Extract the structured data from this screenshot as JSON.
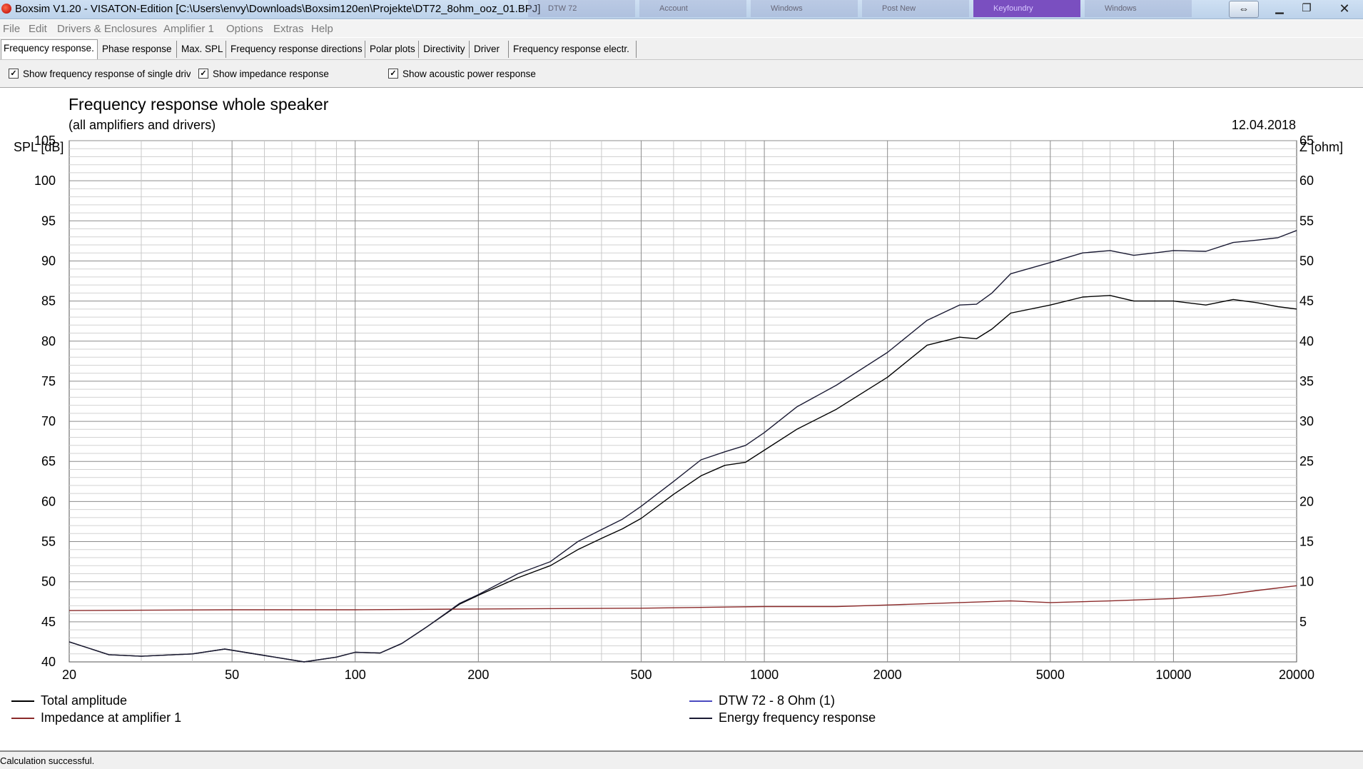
{
  "window": {
    "title": "Boxsim V1.20 - VISATON-Edition [C:\\Users\\envy\\Downloads\\Boxsim120en\\Projekte\\DT72_8ohm_ooz_01.BPJ]",
    "taskbar_tabs": [
      "DTW 72",
      "Account",
      "Windows",
      "Post New",
      "Keyfoundry",
      "Windows"
    ]
  },
  "menu": [
    "File",
    "Edit",
    "Drivers & Enclosures",
    "Amplifier 1",
    "Options",
    "Extras",
    "Help"
  ],
  "tabs": [
    "Frequency response.",
    "Phase response",
    "Max. SPL",
    "Frequency response directions",
    "Polar plots",
    "Directivity",
    "Driver",
    "Frequency response electr."
  ],
  "options": {
    "single_drivers": {
      "label": "Show frequency response of single drive",
      "checked": true
    },
    "impedance": {
      "label": "Show impedance response",
      "checked": true
    },
    "acoustic_power": {
      "label": "Show acoustic power response",
      "checked": true
    }
  },
  "chart_data": {
    "type": "line",
    "title": "Frequency response whole speaker",
    "subtitle": "(all amplifiers and drivers)",
    "date": "12.04.2018",
    "ylabel": "SPL [dB]",
    "y2label": "Z [ohm]",
    "x_scale": "log",
    "xlim": [
      20,
      20000
    ],
    "ylim": [
      40,
      105
    ],
    "y2lim": [
      0,
      65
    ],
    "x_ticks": [
      "20",
      "50",
      "100",
      "200",
      "500",
      "1000",
      "2000",
      "5000",
      "10000",
      "20000"
    ],
    "y_ticks": [
      "40",
      "45",
      "50",
      "55",
      "60",
      "65",
      "70",
      "75",
      "80",
      "85",
      "90",
      "95",
      "100",
      "105"
    ],
    "y2_ticks": [
      "5",
      "10",
      "15",
      "20",
      "25",
      "30",
      "35",
      "40",
      "45",
      "50",
      "55",
      "60",
      "65"
    ],
    "grid": true,
    "series": [
      {
        "name": "Total amplitude",
        "color": "#000000",
        "axis": "left",
        "x": [
          20,
          25,
          30,
          40,
          48,
          60,
          75,
          90,
          100,
          115,
          130,
          150,
          180,
          200,
          250,
          300,
          350,
          400,
          450,
          500,
          600,
          700,
          800,
          900,
          1000,
          1200,
          1500,
          2000,
          2500,
          3000,
          3300,
          3600,
          4000,
          5000,
          6000,
          7000,
          8000,
          9000,
          10000,
          12000,
          14000,
          16000,
          18000,
          20000
        ],
        "y": [
          42.5,
          40.9,
          40.7,
          41.0,
          41.6,
          40.8,
          40.0,
          40.6,
          41.2,
          41.1,
          42.3,
          44.4,
          47.2,
          48.3,
          50.5,
          52.0,
          54.0,
          55.4,
          56.6,
          57.9,
          60.9,
          63.2,
          64.5,
          64.9,
          66.4,
          69.0,
          71.5,
          75.5,
          79.5,
          80.5,
          80.3,
          81.5,
          83.5,
          84.5,
          85.5,
          85.7,
          85.0,
          85.0,
          85.0,
          84.5,
          85.2,
          84.8,
          84.3,
          84.0
        ]
      },
      {
        "name": "Impedance at amplifier 1",
        "color": "#8b2a2a",
        "axis": "right",
        "x": [
          20,
          50,
          100,
          200,
          500,
          1000,
          1500,
          2000,
          3000,
          4000,
          5000,
          7000,
          10000,
          13000,
          16000,
          20000
        ],
        "y": [
          6.4,
          6.5,
          6.5,
          6.6,
          6.7,
          6.9,
          6.9,
          7.1,
          7.4,
          7.6,
          7.4,
          7.6,
          7.9,
          8.3,
          8.9,
          9.5
        ]
      },
      {
        "name": "DTW 72 - 8 Ohm (1)",
        "color": "#4a4ac0",
        "axis": "left",
        "x": [],
        "y": []
      },
      {
        "name": "Energy frequency response",
        "color": "#1a1a33",
        "axis": "left",
        "x": [
          20,
          25,
          30,
          40,
          48,
          60,
          75,
          90,
          100,
          115,
          130,
          150,
          180,
          200,
          250,
          300,
          350,
          400,
          450,
          500,
          600,
          700,
          800,
          900,
          1000,
          1200,
          1500,
          2000,
          2500,
          3000,
          3300,
          3600,
          4000,
          5000,
          6000,
          7000,
          8000,
          9000,
          10000,
          12000,
          14000,
          16000,
          18000,
          20000
        ],
        "y": [
          42.5,
          40.9,
          40.7,
          41.0,
          41.6,
          40.8,
          40.0,
          40.6,
          41.2,
          41.1,
          42.3,
          44.4,
          47.3,
          48.4,
          51.0,
          52.5,
          55.0,
          56.5,
          57.8,
          59.4,
          62.5,
          65.2,
          66.2,
          67.0,
          68.6,
          71.8,
          74.5,
          78.6,
          82.6,
          84.5,
          84.6,
          86.0,
          88.4,
          89.8,
          91.0,
          91.3,
          90.7,
          91.0,
          91.3,
          91.2,
          92.3,
          92.6,
          92.9,
          93.8
        ]
      }
    ]
  },
  "status": "Calculation successful."
}
